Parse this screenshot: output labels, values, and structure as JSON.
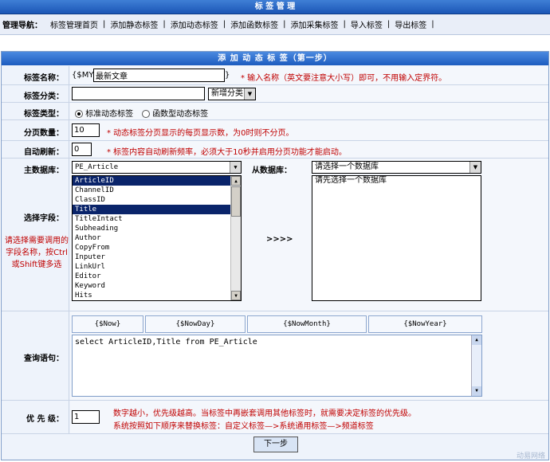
{
  "header": {
    "title": "标 签 管 理"
  },
  "nav": {
    "label": "管理导航：",
    "items": [
      "标签管理首页",
      "添加静态标签",
      "添加动态标签",
      "添加函数标签",
      "添加采集标签",
      "导入标签",
      "导出标签"
    ],
    "separator": "|"
  },
  "panel": {
    "title": "添 加 动 态 标 签（第一步）"
  },
  "form": {
    "tag_name": {
      "label": "标签名称：",
      "prefix": "{$MY_",
      "value": "最新文章",
      "suffix": "}",
      "note": "* 输入名称（英文要注意大小写）即可，不用输入定界符。"
    },
    "tag_category": {
      "label": "标签分类：",
      "value": "",
      "select_value": "新增分类"
    },
    "tag_type": {
      "label": "标签类型：",
      "option1": "标准动态标签",
      "option2": "函数型动态标签",
      "selected": "标准动态标签"
    },
    "page_size": {
      "label": "分页数量：",
      "value": "10",
      "note": "* 动态标签分页显示的每页显示数，为0时则不分页。"
    },
    "auto_refresh": {
      "label": "自动刷新：",
      "value": "0",
      "note": "* 标签内容自动刷新频率，必须大于10秒并启用分页功能才能启动。"
    },
    "main_db": {
      "label": "主数据库：",
      "value": "PE_Article"
    },
    "sub_db": {
      "label": "从数据库：",
      "value": "请选择一个数据库",
      "list_item": "请先选择一个数据库"
    },
    "fields": {
      "label": "选择字段：",
      "hint": "请选择需要调用的字段名称，按Ctrl或Shift键多选",
      "items": [
        "ArticleID",
        "ChannelID",
        "ClassID",
        "Title",
        "TitleIntact",
        "Subheading",
        "Author",
        "CopyFrom",
        "Inputer",
        "LinkUrl",
        "Editor",
        "Keyword",
        "Hits"
      ],
      "selected": [
        "ArticleID",
        "Title"
      ],
      "arrow": ">>>>"
    },
    "query": {
      "label": "查询语句：",
      "var_buttons": [
        "{$Now}",
        "{$NowDay}",
        "{$NowMonth}",
        "{$NowYear}"
      ],
      "value": "select ArticleID,Title from PE_Article"
    },
    "priority": {
      "label": "优 先 级：",
      "value": "1",
      "note1": "数字越小，优先级越高。当标签中再嵌套调用其他标签时，就需要决定标签的优先级。",
      "note2": "系统按照如下顺序来替换标签：自定义标签—>系统通用标签—>频道标签"
    },
    "next_button": "下一步"
  },
  "watermark": "动易网络"
}
